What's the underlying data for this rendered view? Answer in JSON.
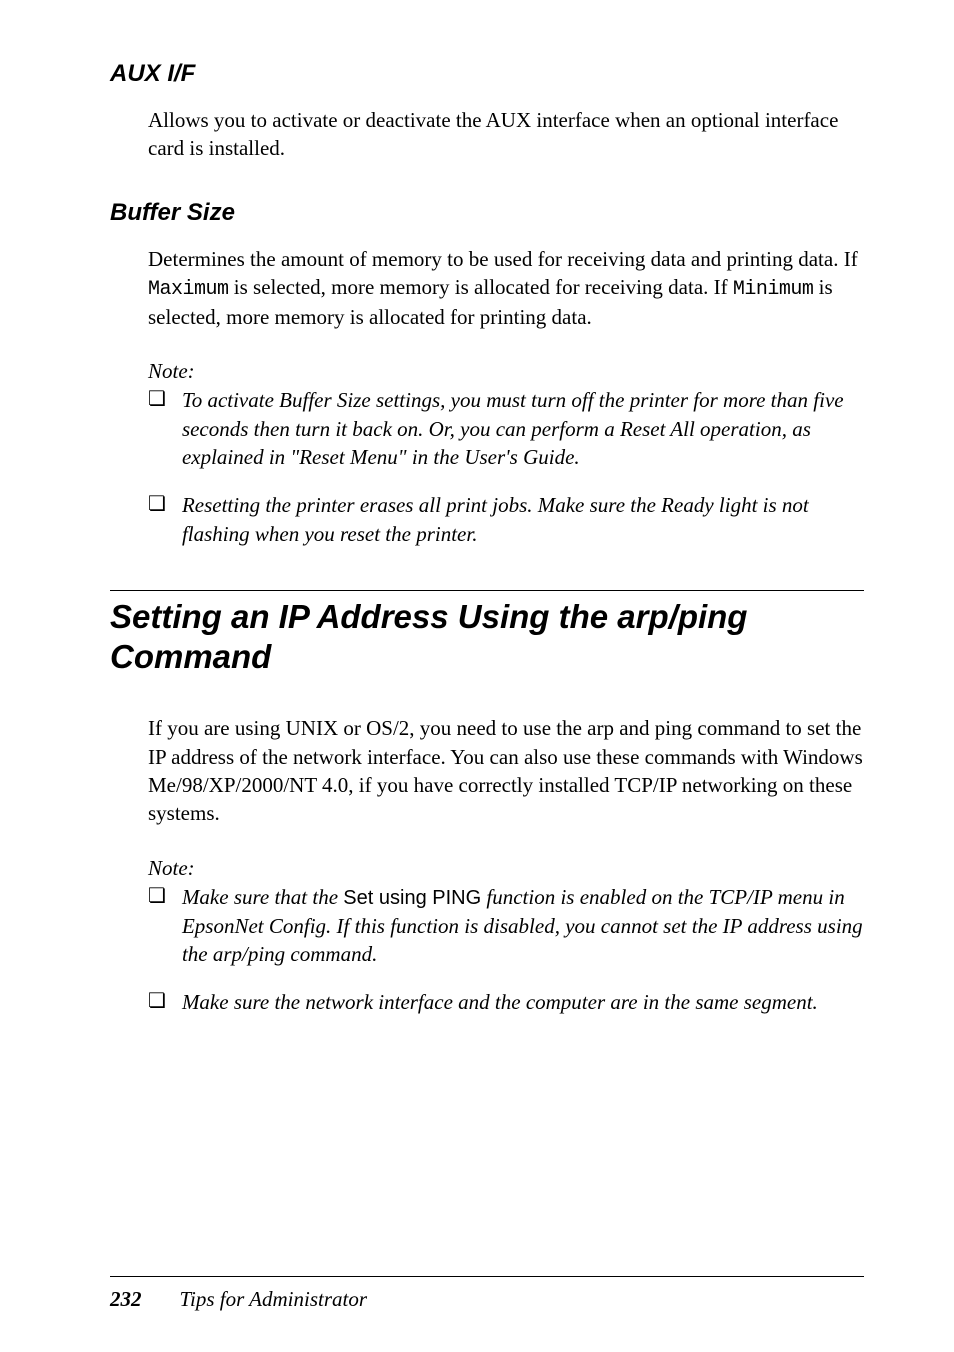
{
  "section1": {
    "heading": "AUX I/F",
    "body": "Allows you to activate or deactivate the AUX interface when an optional interface card is installed."
  },
  "section2": {
    "heading": "Buffer Size",
    "body_pre1": "Determines the amount of memory to be used for receiving data and printing data. If ",
    "mono1": "Maximum",
    "body_mid1": " is selected, more memory is allocated for receiving data. If ",
    "mono2": "Minimum",
    "body_post1": " is selected, more memory is allocated for printing data.",
    "note_label": "Note:",
    "note1": "To activate Buffer Size settings, you must turn off the printer for more than five seconds then turn it back on. Or, you can perform a Reset All operation, as explained in \"Reset Menu\" in the User's Guide.",
    "note2": "Resetting the printer erases all print jobs. Make sure the Ready light is not flashing when you reset the printer."
  },
  "section3": {
    "heading": "Setting an IP Address Using the arp/ping Command",
    "body": "If you are using UNIX or OS/2, you need to use the arp and ping command to set the IP address of the network interface. You can also use these commands with Windows Me/98/XP/2000/NT 4.0, if you have correctly installed TCP/IP networking on these systems.",
    "note_label": "Note:",
    "note1_pre": "Make sure that the ",
    "note1_sans": "Set using PING",
    "note1_post": " function is enabled on the TCP/IP menu in EpsonNet Config. If this function is disabled, you cannot set the IP address using the arp/ping command.",
    "note2": "Make sure the network interface and the computer are in the same segment."
  },
  "footer": {
    "page": "232",
    "title": "Tips for Administrator"
  },
  "bullet": "❏"
}
